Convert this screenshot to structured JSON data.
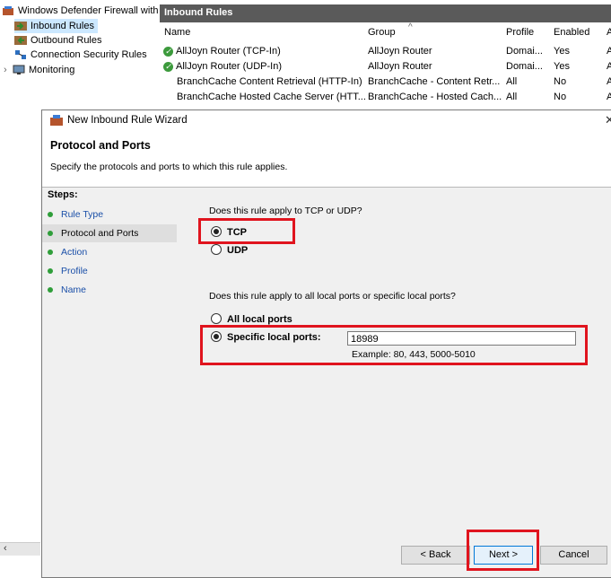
{
  "tree": {
    "root": "Windows Defender Firewall with",
    "items": [
      {
        "label": "Inbound Rules"
      },
      {
        "label": "Outbound Rules"
      },
      {
        "label": "Connection Security Rules"
      },
      {
        "label": "Monitoring"
      }
    ]
  },
  "rules_panel": {
    "title": "Inbound Rules",
    "columns": [
      "Name",
      "Group",
      "Profile",
      "Enabled",
      "A"
    ],
    "rows": [
      {
        "name": "AllJoyn Router (TCP-In)",
        "group": "AllJoyn Router",
        "profile": "Domai...",
        "enabled": "Yes",
        "extra": "A"
      },
      {
        "name": "AllJoyn Router (UDP-In)",
        "group": "AllJoyn Router",
        "profile": "Domai...",
        "enabled": "Yes",
        "extra": "A"
      },
      {
        "name": "BranchCache Content Retrieval (HTTP-In)",
        "group": "BranchCache - Content Retr...",
        "profile": "All",
        "enabled": "No",
        "extra": "A"
      },
      {
        "name": "BranchCache Hosted Cache Server (HTT...",
        "group": "BranchCache - Hosted Cach...",
        "profile": "All",
        "enabled": "No",
        "extra": "A"
      }
    ]
  },
  "wizard": {
    "title": "New Inbound Rule Wizard",
    "heading": "Protocol and Ports",
    "subheading": "Specify the protocols and ports to which this rule applies.",
    "steps_label": "Steps:",
    "steps": [
      "Rule Type",
      "Protocol and Ports",
      "Action",
      "Profile",
      "Name"
    ],
    "active_step": "Protocol and Ports",
    "question_protocol": "Does this rule apply to TCP or UDP?",
    "protocol_options": [
      "TCP",
      "UDP"
    ],
    "protocol_selected": "TCP",
    "question_ports": "Does this rule apply to all local ports or specific local ports?",
    "port_options": [
      "All local ports",
      "Specific local ports:"
    ],
    "port_selected": "Specific local ports:",
    "ports_value": "18989",
    "ports_example": "Example: 80, 443, 5000-5010",
    "buttons": {
      "back": "< Back",
      "next": "Next >",
      "cancel": "Cancel"
    }
  },
  "colors": {
    "highlight": "#e0141e",
    "header_bg": "#5a5a5a",
    "step_dot": "#2f9e3a",
    "step_link": "#1a4fa8"
  }
}
